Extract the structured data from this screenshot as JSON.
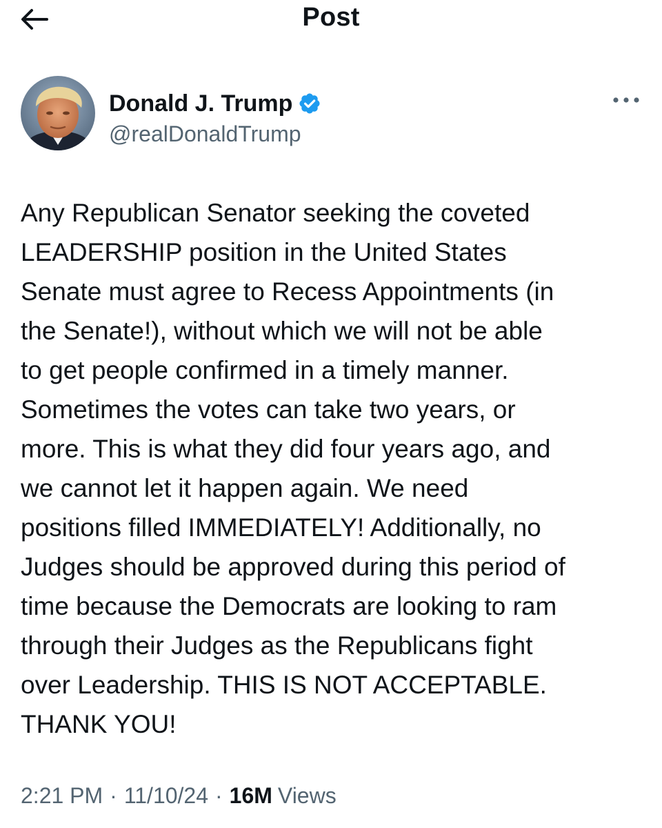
{
  "header": {
    "title": "Post",
    "back_icon": "arrow-left-icon"
  },
  "author": {
    "name": "Donald J. Trump",
    "handle": "@realDonaldTrump",
    "verified_icon": "verified-badge-icon",
    "verified_color": "#1d9bf0",
    "more_icon": "more-horizontal-icon"
  },
  "post": {
    "text": "Any Republican Senator seeking the coveted\nLEADERSHIP position in the United States\nSenate must agree to Recess Appointments (in\nthe Senate!), without which we will not be able\nto get people confirmed in a timely manner.\nSometimes the votes can take two years, or\nmore. This is what they did four years ago, and\nwe cannot let it happen again. We need\npositions filled IMMEDIATELY! Additionally, no\nJudges should be approved during this period of\ntime because the Democrats are looking to ram\nthrough their Judges as the Republicans fight\nover Leadership. THIS IS NOT ACCEPTABLE.\nTHANK YOU!"
  },
  "meta": {
    "time": "2:21 PM",
    "separator": "·",
    "date": "11/10/24",
    "views_count": "16M",
    "views_label": "Views"
  },
  "colors": {
    "text_primary": "#0f1419",
    "text_secondary": "#536471",
    "accent": "#1d9bf0"
  }
}
